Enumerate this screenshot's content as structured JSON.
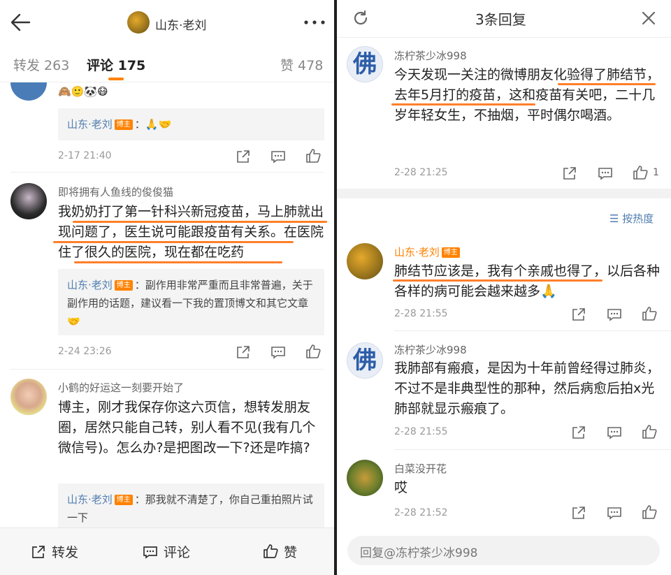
{
  "left": {
    "header_title": "山东·老刘",
    "tabs": {
      "repost": "转发 263",
      "comment": "评论 175",
      "like": "赞 478"
    },
    "c1": {
      "emoji": "🙈🙂🐼😷",
      "reply_name": "山东·老刘",
      "badge": "博主",
      "reply_text": "：🙏🤝",
      "time": "2-17 21:40"
    },
    "c2": {
      "name": "即将拥有人鱼线的俊俊猫",
      "text": "我奶奶打了第一针科兴新冠疫苗，马上肺就出现问题了，医生说可能跟疫苗有关系。在医院住了很久的医院，现在都在吃药",
      "reply_name": "山东·老刘",
      "badge": "博主",
      "reply_text": "：副作用非常严重而且非常普遍，关于副作用的话题，建议看一下我的置顶博文和其它文章🤝",
      "time": "2-24 23:26"
    },
    "c3": {
      "name": "小鹤的好运这一刻要开始了",
      "text": "博主，刚才我保存你这六页信，想转发朋友圈，居然只能自己转，别人看不见(我有几个微信号)。怎么办?是把图改一下?还是咋搞?",
      "reply_name": "山东·老刘",
      "badge": "博主",
      "reply_text": "：那我就不清楚了，你自己重拍照片试一下"
    },
    "bottom": {
      "repost": "转发",
      "comment": "评论",
      "like": "赞"
    }
  },
  "right": {
    "title": "3条回复",
    "main": {
      "name": "冻柠茶少冰998",
      "text": "今天发现一关注的微博朋友化验得了肺结节，去年5月打的疫苗，这和疫苗有关吧，二十几岁年轻女生，不抽烟，平时偶尔喝酒。",
      "time": "2-28 21:25",
      "likes": "1",
      "avatar_char": "佛"
    },
    "sort": "按热度",
    "replies": [
      {
        "name": "山东·老刘",
        "badge": "博主",
        "text": "肺结节应该是，我有个亲戚也得了，以后各种各样的病可能会越来越多🙏",
        "time": "2-28 21:55"
      },
      {
        "name": "冻柠茶少冰998",
        "text": "我肺部有瘢痕，是因为十年前曾经得过肺炎，不过不是非典型性的那种，然后病愈后拍x光肺部就显示瘢痕了。",
        "time": "2-28 21:55",
        "avatar_char": "佛"
      },
      {
        "name": "白菜没开花",
        "text": "哎",
        "time": "2-28 21:52"
      }
    ],
    "input_placeholder": "回复@冻柠茶少冰998"
  }
}
